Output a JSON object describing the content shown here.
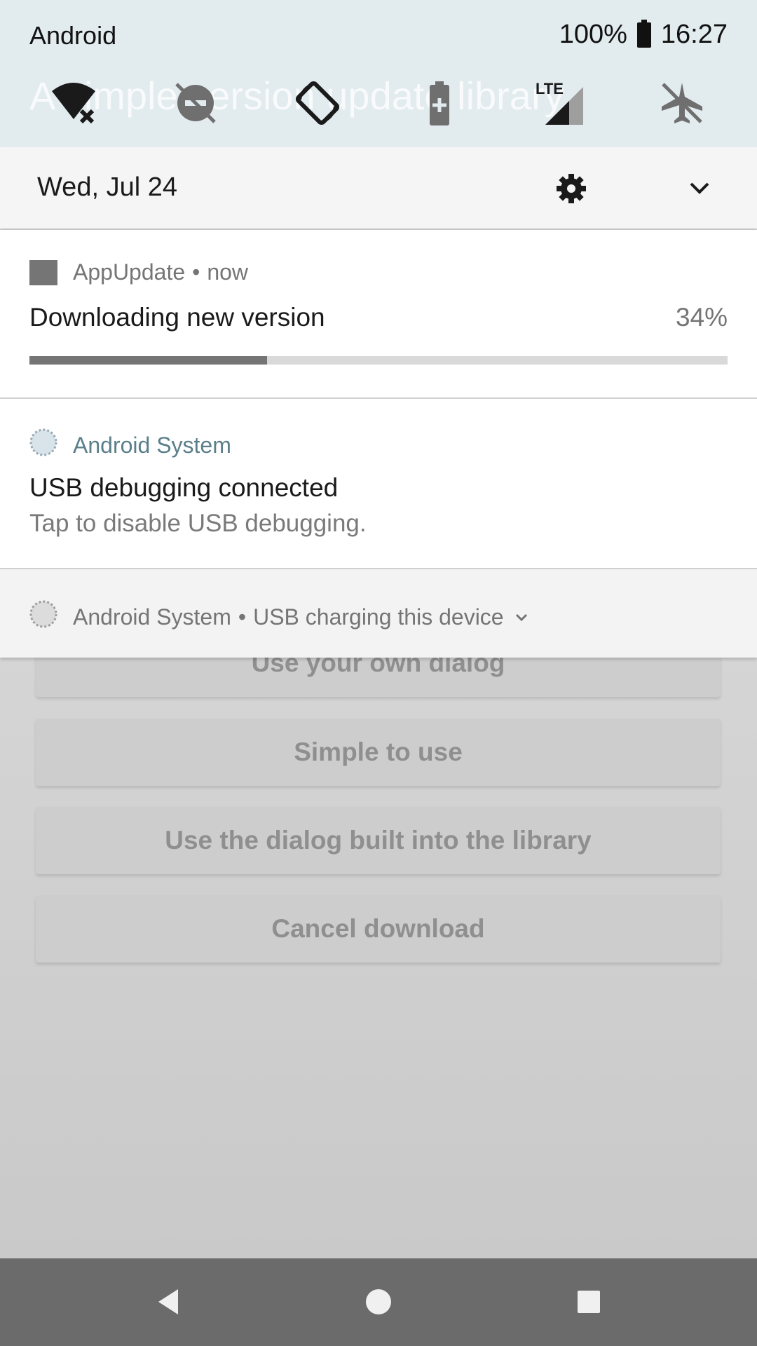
{
  "status_bar": {
    "carrier": "Android",
    "battery_percent": "100%",
    "time": "16:27"
  },
  "quick_settings": {
    "tiles": [
      "wifi-off-icon",
      "do-not-disturb-icon",
      "auto-rotate-icon",
      "battery-saver-icon",
      "lte-signal-icon",
      "airplane-mode-icon"
    ],
    "date": "Wed, Jul 24"
  },
  "background_app": {
    "title": "A simple version update library",
    "buttons": [
      "Use your own dialog",
      "Simple to use",
      "Use the dialog built into the library",
      "Cancel download"
    ]
  },
  "notifications": [
    {
      "app": "AppUpdate",
      "time": "now",
      "separator": "•",
      "title": "Downloading new version",
      "progress_label": "34%",
      "progress": 0.34
    },
    {
      "app": "Android System",
      "title": "USB debugging connected",
      "text": "Tap to disable USB debugging."
    },
    {
      "app": "Android System",
      "separator": "•",
      "summary": "USB charging this device"
    }
  ],
  "nav_bar": {
    "buttons": [
      "back-icon",
      "home-icon",
      "recents-icon"
    ]
  },
  "colors": {
    "accent_system": "#5b7f8a",
    "progress_fill": "#757575",
    "progress_track": "#d9d9d9",
    "nav_bar": "#6b6b6b"
  }
}
